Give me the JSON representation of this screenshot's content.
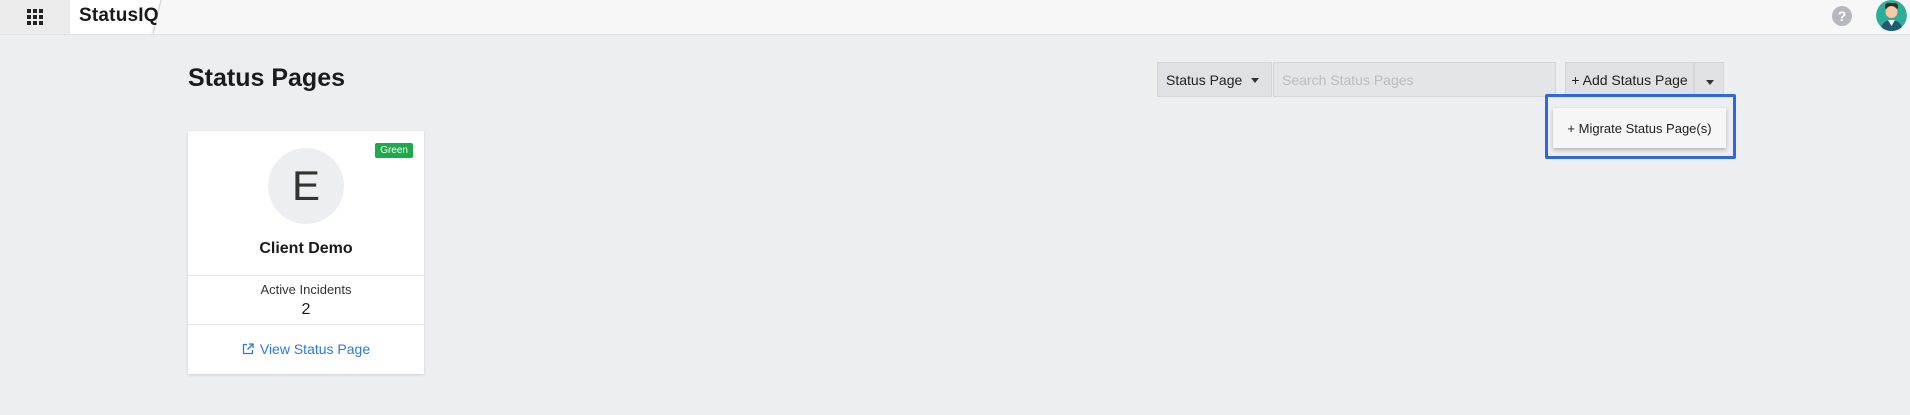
{
  "topbar": {
    "app_name": "StatusIQ",
    "help_label": "?"
  },
  "header": {
    "title": "Status Pages",
    "type_select": {
      "selected": "Status Page"
    },
    "search": {
      "placeholder": "Search Status Pages"
    },
    "add_button_label": "+ Add Status Page",
    "dropdown_items": [
      "+ Migrate Status Page(s)"
    ]
  },
  "cards": [
    {
      "initial": "E",
      "badge": "Green",
      "name": "Client Demo",
      "incidents_label": "Active Incidents",
      "incidents_count": "2",
      "link_label": "View Status Page"
    }
  ],
  "colors": {
    "accent": "#2f67e0",
    "link": "#2a7ad8",
    "badge_green": "#1ea94c",
    "background": "#edeef0"
  },
  "icons": {
    "apps": "grid-icon",
    "help": "help-icon",
    "avatar": "user-avatar",
    "external": "external-link-icon"
  }
}
